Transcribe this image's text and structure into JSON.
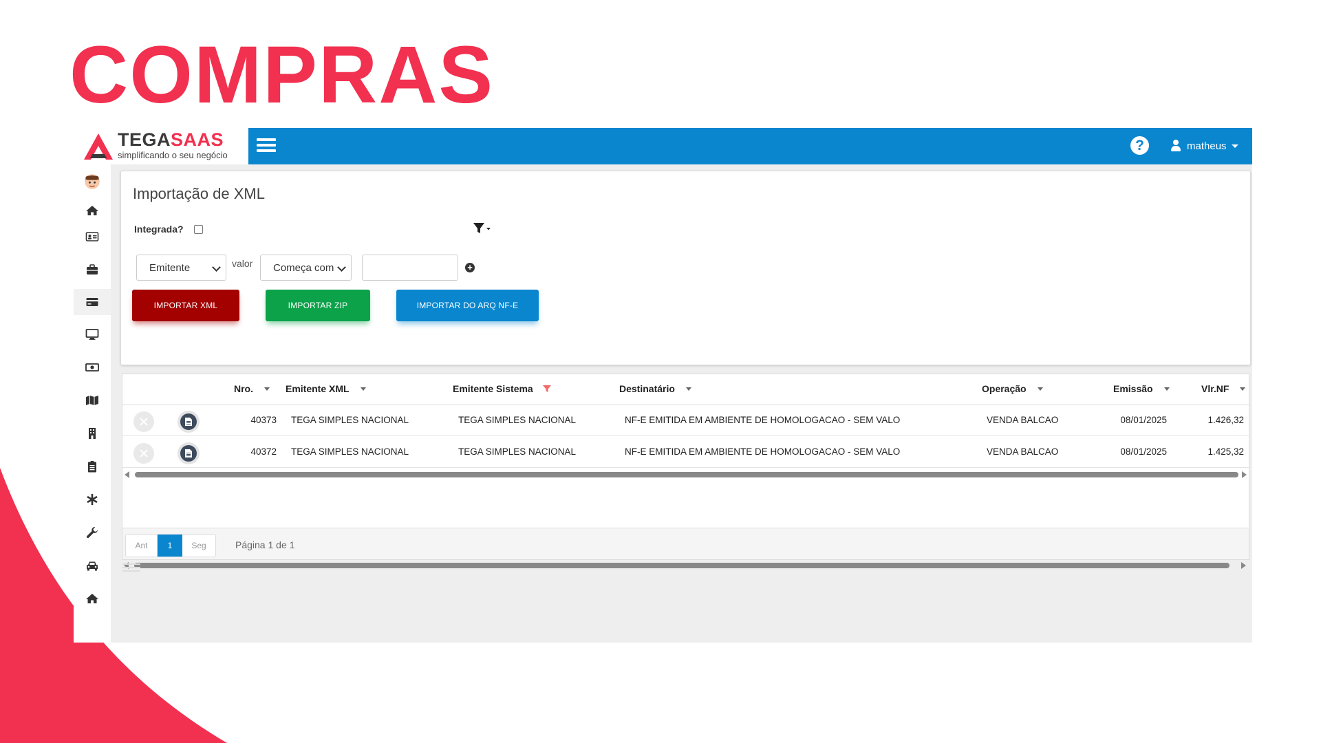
{
  "slide": {
    "title": "COMPRAS"
  },
  "colors": {
    "accent": "#f2304f",
    "topbar": "#0a86cf",
    "btn_red": "#a30000",
    "btn_green": "#0ba24a",
    "btn_blue": "#0a86cf"
  },
  "brand": {
    "name_part1": "TEGA",
    "name_part2": "SAAS",
    "tagline": "simplificando o seu negócio"
  },
  "header": {
    "help_icon": "question-circle-icon",
    "user_name": "matheus"
  },
  "sidebar": {
    "items": [
      {
        "icon": "avatar-icon"
      },
      {
        "icon": "home-icon"
      },
      {
        "icon": "id-card-icon"
      },
      {
        "icon": "briefcase-icon"
      },
      {
        "icon": "credit-card-icon",
        "active": true
      },
      {
        "icon": "monitor-icon"
      },
      {
        "icon": "money-bill-icon"
      },
      {
        "icon": "map-icon"
      },
      {
        "icon": "building-icon"
      },
      {
        "icon": "clipboard-icon"
      },
      {
        "icon": "asterisk-icon"
      },
      {
        "icon": "wrench-icon"
      },
      {
        "icon": "car-icon"
      },
      {
        "icon": "home-icon"
      }
    ]
  },
  "panel": {
    "title": "Importação de XML",
    "integrada_label": "Integrada?",
    "filter_field": "Emitente",
    "valor_label": "valor",
    "filter_operator": "Começa com",
    "filter_value": "",
    "buttons": {
      "import_xml": "IMPORTAR XML",
      "import_zip": "IMPORTAR ZIP",
      "import_nfe": "IMPORTAR DO ARQ NF-E"
    }
  },
  "grid": {
    "columns": {
      "nro": "Nro.",
      "emitente_xml": "Emitente XML",
      "emitente_sistema": "Emitente Sistema",
      "destinatario": "Destinatário",
      "operacao": "Operação",
      "emissao": "Emissão",
      "vlr_nf": "Vlr.NF"
    },
    "rows": [
      {
        "nro": "40373",
        "emitente_xml": "TEGA SIMPLES NACIONAL",
        "emitente_sistema": "TEGA SIMPLES NACIONAL",
        "destinatario": "NF-E EMITIDA EM AMBIENTE DE HOMOLOGACAO - SEM VALO",
        "operacao": "VENDA BALCAO",
        "emissao": "08/01/2025",
        "vlr_nf": "1.426,32"
      },
      {
        "nro": "40372",
        "emitente_xml": "TEGA SIMPLES NACIONAL",
        "emitente_sistema": "TEGA SIMPLES NACIONAL",
        "destinatario": "NF-E EMITIDA EM AMBIENTE DE HOMOLOGACAO - SEM VALO",
        "operacao": "VENDA BALCAO",
        "emissao": "08/01/2025",
        "vlr_nf": "1.425,32"
      }
    ]
  },
  "pager": {
    "prev": "Ant",
    "current": "1",
    "next": "Seg",
    "info": "Página 1 de 1"
  }
}
